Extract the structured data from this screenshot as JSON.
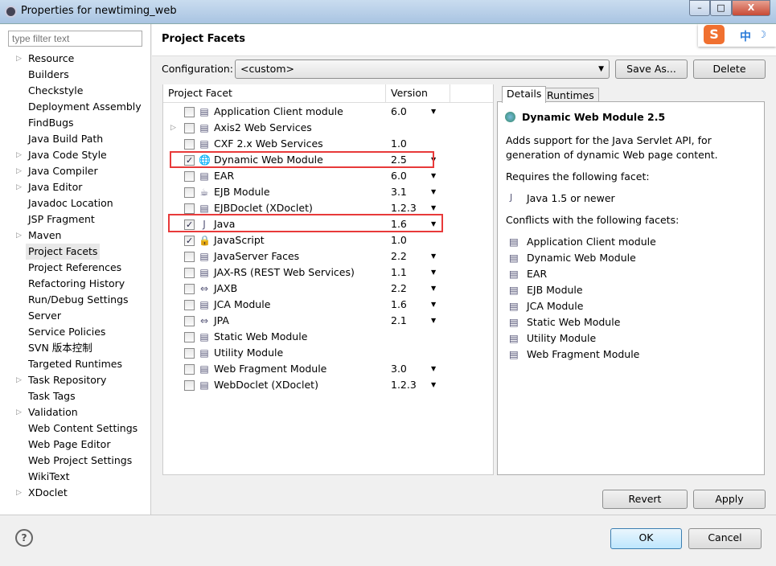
{
  "window": {
    "title": "Properties for newtiming_web",
    "min": "–",
    "max": "□",
    "close": "X"
  },
  "filter_placeholder": "type filter text",
  "sidebar": [
    {
      "label": "Resource",
      "expand": true
    },
    {
      "label": "Builders"
    },
    {
      "label": "Checkstyle"
    },
    {
      "label": "Deployment Assembly"
    },
    {
      "label": "FindBugs"
    },
    {
      "label": "Java Build Path"
    },
    {
      "label": "Java Code Style",
      "expand": true
    },
    {
      "label": "Java Compiler",
      "expand": true
    },
    {
      "label": "Java Editor",
      "expand": true
    },
    {
      "label": "Javadoc Location"
    },
    {
      "label": "JSP Fragment"
    },
    {
      "label": "Maven",
      "expand": true
    },
    {
      "label": "Project Facets",
      "selected": true
    },
    {
      "label": "Project References"
    },
    {
      "label": "Refactoring History"
    },
    {
      "label": "Run/Debug Settings"
    },
    {
      "label": "Server"
    },
    {
      "label": "Service Policies"
    },
    {
      "label": "SVN 版本控制"
    },
    {
      "label": "Targeted Runtimes"
    },
    {
      "label": "Task Repository",
      "expand": true
    },
    {
      "label": "Task Tags"
    },
    {
      "label": "Validation",
      "expand": true
    },
    {
      "label": "Web Content Settings"
    },
    {
      "label": "Web Page Editor"
    },
    {
      "label": "Web Project Settings"
    },
    {
      "label": "WikiText"
    },
    {
      "label": "XDoclet",
      "expand": true
    }
  ],
  "page_title": "Project Facets",
  "ime": {
    "logo": "S",
    "lang": "中"
  },
  "configuration": {
    "label": "Configuration:",
    "value": "<custom>",
    "save_as": "Save As...",
    "delete": "Delete"
  },
  "table": {
    "col_facet": "Project Facet",
    "col_version": "Version",
    "rows": [
      {
        "name": "Application Client module",
        "version": "6.0",
        "checked": false,
        "dd": true
      },
      {
        "name": "Axis2 Web Services",
        "version": "",
        "checked": false,
        "expand": true
      },
      {
        "name": "CXF 2.x Web Services",
        "version": "1.0",
        "checked": false
      },
      {
        "name": "Dynamic Web Module",
        "version": "2.5",
        "checked": true,
        "dd": true,
        "icon": "globe"
      },
      {
        "name": "EAR",
        "version": "6.0",
        "checked": false,
        "dd": true
      },
      {
        "name": "EJB Module",
        "version": "3.1",
        "checked": false,
        "dd": true,
        "icon": "bean"
      },
      {
        "name": "EJBDoclet (XDoclet)",
        "version": "1.2.3",
        "checked": false,
        "dd": true
      },
      {
        "name": "Java",
        "version": "1.6",
        "checked": true,
        "dd": true,
        "icon": "java"
      },
      {
        "name": "JavaScript",
        "version": "1.0",
        "checked": true,
        "icon": "lock"
      },
      {
        "name": "JavaServer Faces",
        "version": "2.2",
        "checked": false,
        "dd": true
      },
      {
        "name": "JAX-RS (REST Web Services)",
        "version": "1.1",
        "checked": false,
        "dd": true
      },
      {
        "name": "JAXB",
        "version": "2.2",
        "checked": false,
        "dd": true,
        "icon": "arrows"
      },
      {
        "name": "JCA Module",
        "version": "1.6",
        "checked": false,
        "dd": true
      },
      {
        "name": "JPA",
        "version": "2.1",
        "checked": false,
        "dd": true,
        "icon": "arrows"
      },
      {
        "name": "Static Web Module",
        "version": "",
        "checked": false
      },
      {
        "name": "Utility Module",
        "version": "",
        "checked": false
      },
      {
        "name": "Web Fragment Module",
        "version": "3.0",
        "checked": false,
        "dd": true
      },
      {
        "name": "WebDoclet (XDoclet)",
        "version": "1.2.3",
        "checked": false,
        "dd": true
      }
    ]
  },
  "details": {
    "tab_details": "Details",
    "tab_runtimes": "Runtimes",
    "title": "Dynamic Web Module 2.5",
    "desc1": "Adds support for the Java Servlet API, for",
    "desc2": "generation of dynamic Web page content.",
    "requires_label": "Requires the following facet:",
    "requires": [
      "Java 1.5 or newer"
    ],
    "conflicts_label": "Conflicts with the following facets:",
    "conflicts": [
      "Application Client module",
      "Dynamic Web Module",
      "EAR",
      "EJB Module",
      "JCA Module",
      "Static Web Module",
      "Utility Module",
      "Web Fragment Module"
    ]
  },
  "buttons": {
    "revert": "Revert",
    "apply": "Apply",
    "ok": "OK",
    "cancel": "Cancel",
    "help": "?"
  }
}
